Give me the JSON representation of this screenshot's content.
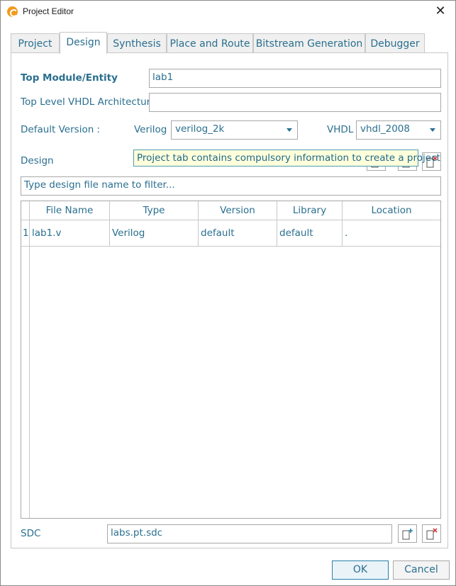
{
  "window": {
    "title": "Project Editor",
    "close_glyph": "✕"
  },
  "tabs": [
    {
      "label": "Project",
      "active": false
    },
    {
      "label": "Design",
      "active": true
    },
    {
      "label": "Synthesis",
      "active": false
    },
    {
      "label": "Place and Route",
      "active": false
    },
    {
      "label": "Bitstream Generation",
      "active": false
    },
    {
      "label": "Debugger",
      "active": false
    }
  ],
  "design": {
    "top_module_label": "Top Module/Entity",
    "top_module_value": "lab1",
    "vhdl_arch_label": "Top Level VHDL Architecture",
    "vhdl_arch_value": "",
    "default_version_label": "Default Version :",
    "verilog_label": "Verilog",
    "verilog_value": "verilog_2k",
    "vhdl_label": "VHDL",
    "vhdl_value": "vhdl_2008",
    "design_label": "Design",
    "tooltip": "Project tab contains compulsory information to create a project",
    "filter_placeholder": "Type design file name to filter...",
    "table": {
      "columns": [
        "File Name",
        "Type",
        "Version",
        "Library",
        "Location"
      ],
      "rows": [
        {
          "index": "1",
          "file_name": "lab1.v",
          "type": "Verilog",
          "version": "default",
          "library": "default",
          "location": "."
        }
      ]
    },
    "sdc_label": "SDC",
    "sdc_value": "labs.pt.sdc"
  },
  "buttons": {
    "ok": "OK",
    "cancel": "Cancel"
  },
  "icons": {
    "add": "add-file-icon",
    "remove": "remove-file-icon",
    "app": "app-logo-icon"
  },
  "colors": {
    "text": "#2a6f8f",
    "tooltip_bg": "#ffffdc",
    "add_accent": "#2a7fa8",
    "remove_accent": "#d43c3c",
    "app_logo": "#f19a1d"
  }
}
